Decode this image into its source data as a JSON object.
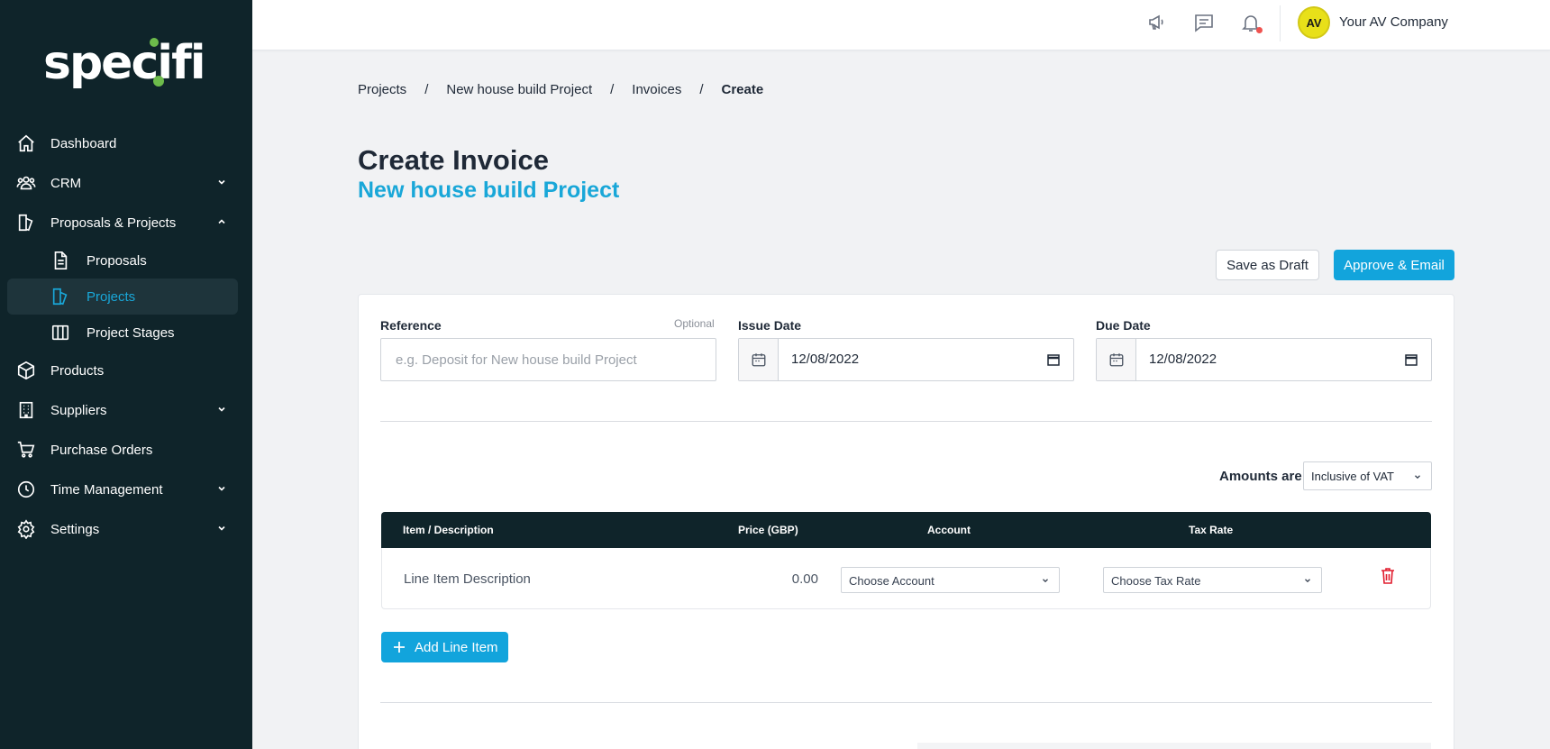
{
  "brand": {
    "logo_text": "specifi",
    "accent": "#19a7d8",
    "sidebar_bg": "#0f242a",
    "logo_green": "#6dbb4b"
  },
  "sidebar": {
    "items": [
      {
        "label": "Dashboard",
        "icon": "home-icon"
      },
      {
        "label": "CRM",
        "icon": "users-icon",
        "expandable": true
      },
      {
        "label": "Proposals & Projects",
        "icon": "proposals-projects-icon",
        "expanded": true,
        "children": [
          {
            "label": "Proposals",
            "icon": "document-icon"
          },
          {
            "label": "Projects",
            "icon": "projects-icon",
            "active": true
          },
          {
            "label": "Project Stages",
            "icon": "columns-icon"
          }
        ]
      },
      {
        "label": "Products",
        "icon": "box-icon"
      },
      {
        "label": "Suppliers",
        "icon": "building-icon",
        "expandable": true
      },
      {
        "label": "Purchase Orders",
        "icon": "cart-icon"
      },
      {
        "label": "Time Management",
        "icon": "clock-icon",
        "expandable": true
      },
      {
        "label": "Settings",
        "icon": "gear-icon",
        "expandable": true
      }
    ]
  },
  "topbar": {
    "icons": [
      "megaphone-icon",
      "chat-icon",
      "bell-icon"
    ],
    "avatar_initials": "AV",
    "company_name": "Your AV Company"
  },
  "breadcrumb": [
    "Projects",
    "New house build Project",
    "Invoices",
    "Create"
  ],
  "page": {
    "title": "Create Invoice",
    "subtitle": "New house build Project"
  },
  "actions": {
    "save_draft": "Save as Draft",
    "approve_email": "Approve & Email"
  },
  "form": {
    "reference": {
      "label": "Reference",
      "optional": "Optional",
      "placeholder": "e.g. Deposit for New house build Project",
      "value": ""
    },
    "issue_date": {
      "label": "Issue Date",
      "value": "12/08/2022"
    },
    "due_date": {
      "label": "Due Date",
      "value": "12/08/2022"
    }
  },
  "amounts": {
    "label": "Amounts are",
    "selected": "Inclusive of VAT"
  },
  "table": {
    "headers": {
      "item": "Item / Description",
      "price": "Price (GBP)",
      "account": "Account",
      "tax": "Tax Rate"
    },
    "rows": [
      {
        "description": "Line Item Description",
        "price": "0.00",
        "account": "Choose Account",
        "tax": "Choose Tax Rate"
      }
    ]
  },
  "add_line": "Add Line Item"
}
